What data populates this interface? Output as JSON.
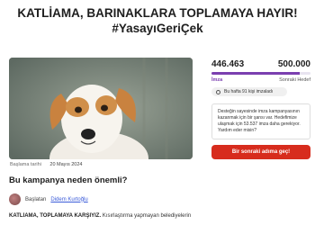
{
  "title": {
    "line1": "KATLİAMA, BARINAKLARA TOPLAMAYA HAYIR!",
    "line2": "#YasayıGeriÇek"
  },
  "start": {
    "label": "Başlama tarihi",
    "date": "20 Mayıs 2024"
  },
  "stats": {
    "signatures": "446.463",
    "goal": "500.000",
    "signatures_label": "İmza",
    "goal_label": "Sonraki Hedef",
    "progress_fraction": 0.893,
    "progress_color": "#7b3fb0"
  },
  "weekly": {
    "count": "Bu hafta 91 kişi imzaladı"
  },
  "callout": {
    "text": "Desteğin sayesinde imza kampanyasının kazanmak için bir şansı var. Hedefimize ulaşmak için 53.537 imza daha gerekiyor.",
    "cta": "Yardım eder misin?"
  },
  "next_button": {
    "label": "Bir sonraki adıma geç!",
    "color": "#d72c1d"
  },
  "why": {
    "heading": "Bu kampanya neden önemli?"
  },
  "starter": {
    "label": "Başlatan",
    "name": "Didem Kurtoğlu"
  },
  "description": {
    "bold": "KATLİAMA, TOPLAMAYA KARŞIYIZ.",
    "rest": "Kısırlaştırma yapmayan belediyelerin"
  }
}
